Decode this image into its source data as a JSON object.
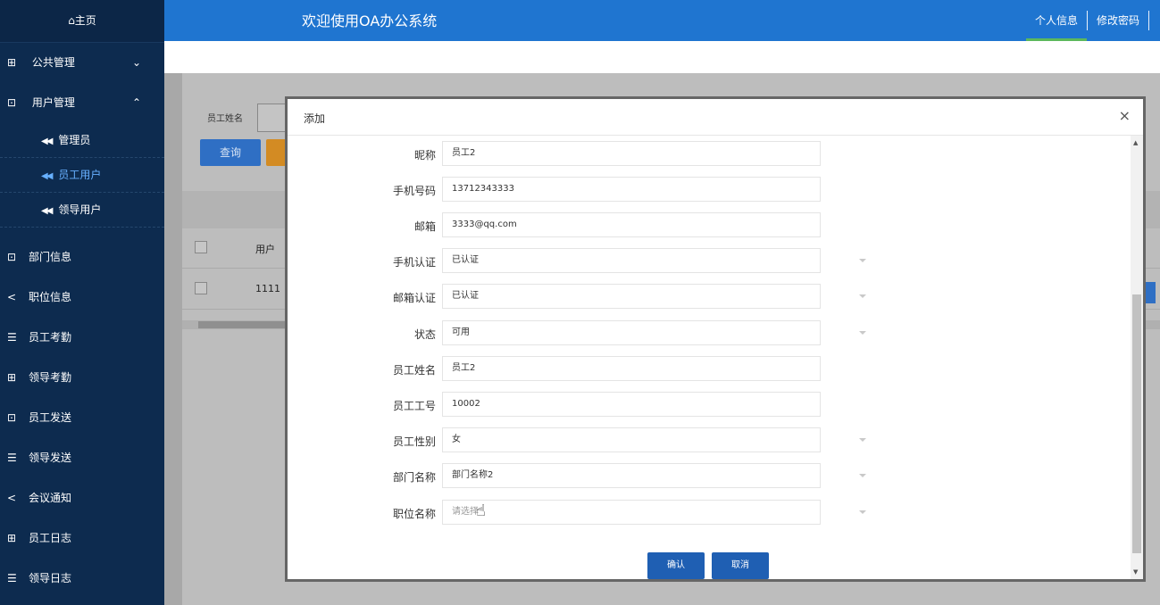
{
  "sidebar": {
    "home": "⌂主页",
    "groups": [
      {
        "icon": "⊞",
        "label": "公共管理",
        "arrow": "⌄"
      },
      {
        "icon": "⊡",
        "label": "用户管理",
        "arrow": "⌃"
      }
    ],
    "sub_items": [
      {
        "prefix": "◀◀",
        "label": "管理员"
      },
      {
        "prefix": "◀◀",
        "label": "员工用户"
      },
      {
        "prefix": "◀◀",
        "label": "领导用户"
      }
    ],
    "items": [
      {
        "icon": "⊡",
        "label": "部门信息"
      },
      {
        "icon": "<",
        "label": "职位信息"
      },
      {
        "icon": "☰",
        "label": "员工考勤"
      },
      {
        "icon": "⊞",
        "label": "领导考勤"
      },
      {
        "icon": "⊡",
        "label": "员工发送"
      },
      {
        "icon": "☰",
        "label": "领导发送"
      },
      {
        "icon": "<",
        "label": "会议通知"
      },
      {
        "icon": "⊞",
        "label": "员工日志"
      },
      {
        "icon": "☰",
        "label": "领导日志"
      }
    ]
  },
  "header": {
    "title": "欢迎使用OA办公系统",
    "personal_info": "个人信息",
    "change_password": "修改密码"
  },
  "background_page": {
    "search_label": "员工姓名",
    "query_button": "查询",
    "col_user": "用户",
    "row_user": "1111"
  },
  "modal": {
    "title": "添加",
    "close": "×",
    "fields": [
      {
        "label": "昵称",
        "value": "员工2",
        "type": "input"
      },
      {
        "label": "手机号码",
        "value": "13712343333",
        "type": "input"
      },
      {
        "label": "邮箱",
        "value": "3333@qq.com",
        "type": "input"
      },
      {
        "label": "手机认证",
        "value": "已认证",
        "type": "select"
      },
      {
        "label": "邮箱认证",
        "value": "已认证",
        "type": "select"
      },
      {
        "label": "状态",
        "value": "可用",
        "type": "select"
      },
      {
        "label": "员工姓名",
        "value": "员工2",
        "type": "input"
      },
      {
        "label": "员工工号",
        "value": "10002",
        "type": "input"
      },
      {
        "label": "员工性别",
        "value": "女",
        "type": "select"
      },
      {
        "label": "部门名称",
        "value": "部门名称2",
        "type": "select"
      },
      {
        "label": "职位名称",
        "value": "请选择",
        "type": "select",
        "placeholder": true
      }
    ],
    "confirm": "确认",
    "cancel": "取消"
  },
  "colors": {
    "header": "#1f75d0",
    "sidebar": "#0d2b4f",
    "active_sub": "#67b0ff",
    "button": "#1f5fb3",
    "active_underline": "#5cb85c"
  }
}
